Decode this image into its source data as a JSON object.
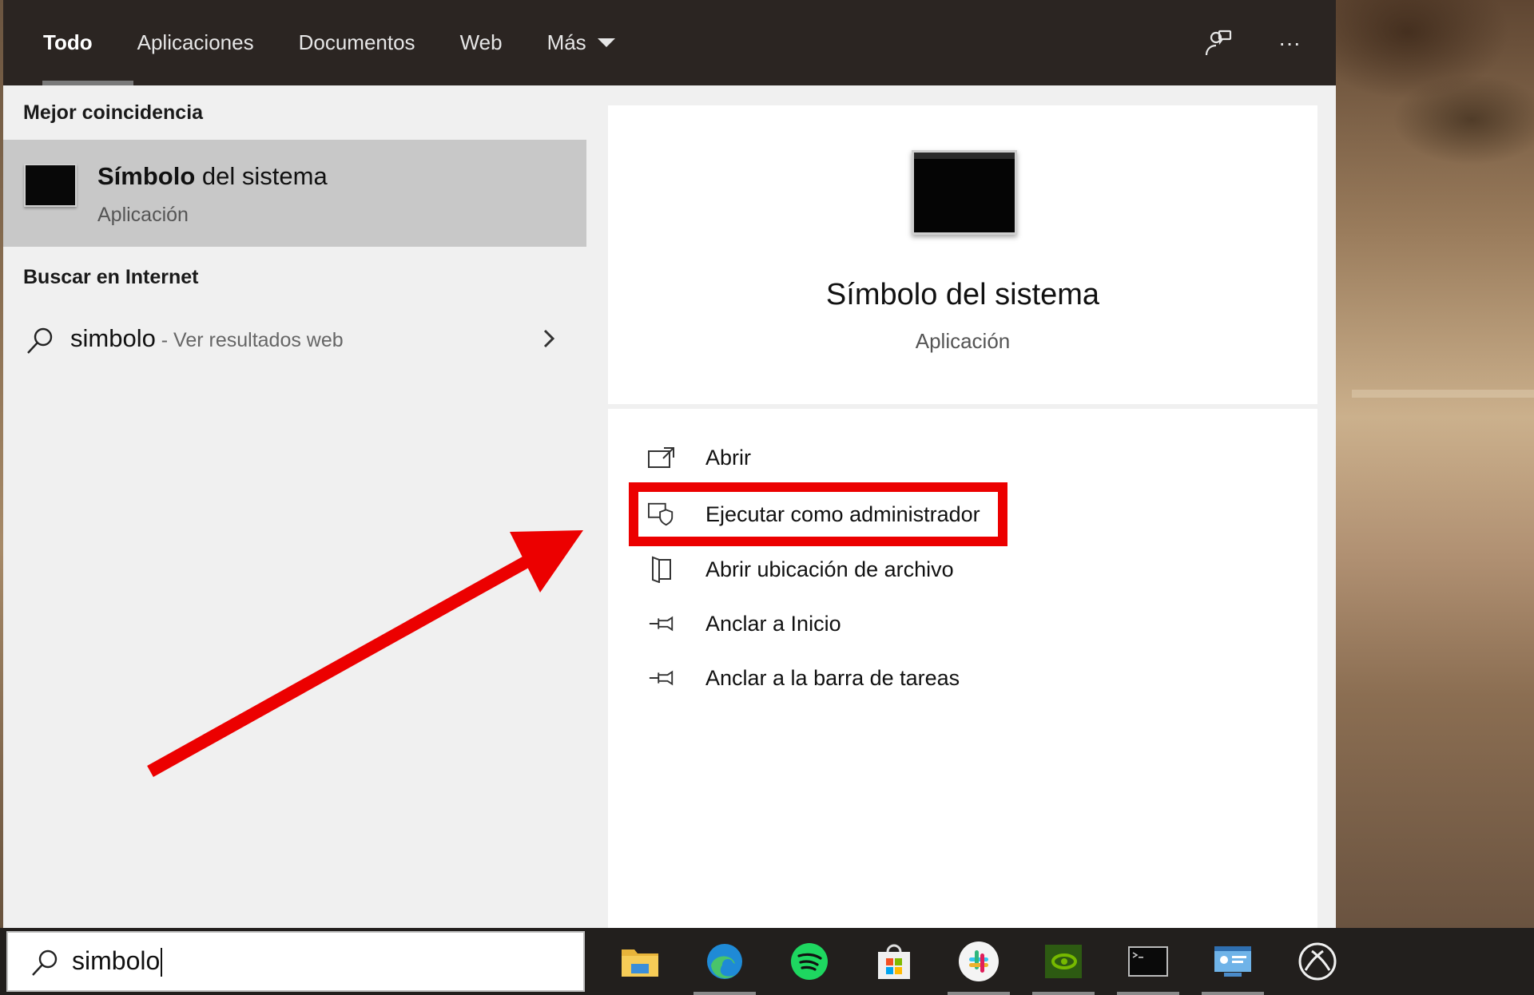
{
  "nav": {
    "tabs": [
      {
        "label": "Todo",
        "active": true
      },
      {
        "label": "Aplicaciones"
      },
      {
        "label": "Documentos"
      },
      {
        "label": "Web"
      },
      {
        "label": "Más"
      }
    ],
    "feedback_icon": "feedback-icon",
    "more_icon": "more-options-icon",
    "more_glyph": "···"
  },
  "left": {
    "best_match_heading": "Mejor coincidencia",
    "best_match": {
      "title_bold": "Símbolo",
      "title_rest": " del sistema",
      "subtitle": "Aplicación",
      "icon": "command-prompt-icon"
    },
    "web_heading": "Buscar en Internet",
    "web_result": {
      "query": "simbolo",
      "suffix": " - Ver resultados web",
      "icon": "search-icon"
    }
  },
  "preview": {
    "title": "Símbolo del sistema",
    "subtitle": "Aplicación",
    "actions": [
      {
        "label": "Abrir",
        "icon": "open-icon"
      },
      {
        "label": "Ejecutar como administrador",
        "icon": "shield-icon",
        "highlighted": true
      },
      {
        "label": "Abrir ubicación de archivo",
        "icon": "file-location-icon"
      },
      {
        "label": "Anclar a Inicio",
        "icon": "pin-icon"
      },
      {
        "label": "Anclar a la barra de tareas",
        "icon": "pin-icon"
      }
    ]
  },
  "taskbar": {
    "search_value": "simbolo",
    "apps": [
      "file-explorer-icon",
      "edge-icon",
      "spotify-icon",
      "store-icon",
      "slack-icon",
      "nvidia-icon",
      "terminal-icon",
      "control-panel-icon",
      "xbox-icon"
    ]
  },
  "colors": {
    "highlight": "#ec0000",
    "nav_bg": "#2b2522",
    "selected_row": "#c8c8c8"
  }
}
